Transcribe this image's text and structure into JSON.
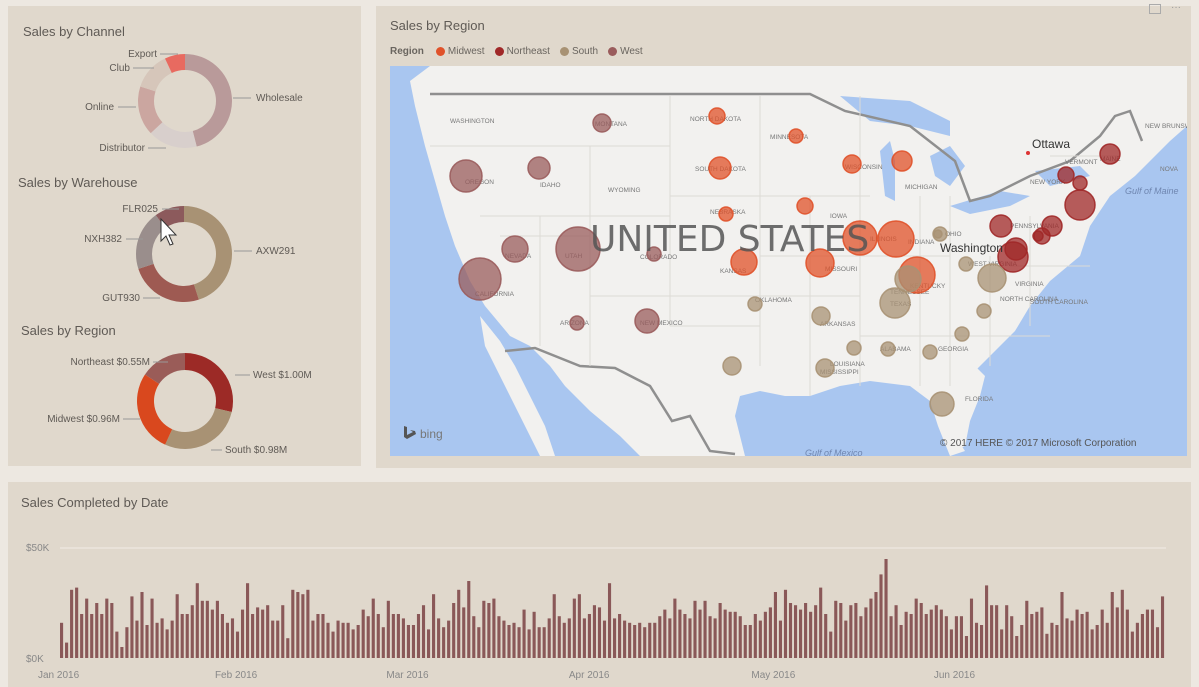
{
  "left_panel": {
    "channel": {
      "title": "Sales by Channel",
      "segments": [
        {
          "label": "Wholesale",
          "share": 0.46,
          "color": "#b99a9a"
        },
        {
          "label": "Distributor",
          "share": 0.17,
          "color": "#d8cfcc"
        },
        {
          "label": "Online",
          "share": 0.17,
          "color": "#cba6a0"
        },
        {
          "label": "Club",
          "share": 0.13,
          "color": "#d6c6ba"
        },
        {
          "label": "Export",
          "share": 0.07,
          "color": "#e86a60"
        }
      ]
    },
    "warehouse": {
      "title": "Sales by Warehouse",
      "segments": [
        {
          "label": "AXW291",
          "share": 0.45,
          "color": "#a89274"
        },
        {
          "label": "GUT930",
          "share": 0.25,
          "color": "#9e5a52"
        },
        {
          "label": "NXH382",
          "share": 0.2,
          "color": "#9a8e8c"
        },
        {
          "label": "FLR025",
          "share": 0.1,
          "color": "#8c5a5c"
        }
      ]
    },
    "region": {
      "title": "Sales by Region",
      "segments": [
        {
          "label": "West $1.00M",
          "share": 0.287,
          "color": "#9c2a26"
        },
        {
          "label": "South $0.98M",
          "share": 0.281,
          "color": "#a89274"
        },
        {
          "label": "Midwest $0.96M",
          "share": 0.275,
          "color": "#d9481e"
        },
        {
          "label": "Northeast $0.55M",
          "share": 0.157,
          "color": "#9a5c58"
        }
      ]
    }
  },
  "map_panel": {
    "title": "Sales by Region",
    "legend_title": "Region",
    "legend": [
      {
        "label": "Midwest",
        "color": "#e0522a"
      },
      {
        "label": "Northeast",
        "color": "#a02828"
      },
      {
        "label": "South",
        "color": "#a89274"
      },
      {
        "label": "West",
        "color": "#9a5c5c"
      }
    ],
    "country_label": "UNITED STATES",
    "city_labels": [
      "Ottawa",
      "Washington"
    ],
    "water_labels": [
      "Gulf of Maine",
      "Gulf of Mexico"
    ],
    "state_labels": [
      "WASHINGTON",
      "MONTANA",
      "NORTH DAKOTA",
      "MINNESOTA",
      "SOUTH DAKOTA",
      "WYOMING",
      "IDAHO",
      "OREGON",
      "NEBRASKA",
      "NEVADA",
      "UTAH",
      "COLORADO",
      "KANSAS",
      "CALIFORNIA",
      "ARIZONA",
      "NEW MEXICO",
      "OKLAHOMA",
      "TEXAS",
      "ARKANSAS",
      "MISSOURI",
      "IOWA",
      "WISCONSIN",
      "MICHIGAN",
      "ILLINOIS",
      "INDIANA",
      "OHIO",
      "KENTUCKY",
      "TENNESSEE",
      "MISSISSIPPI",
      "ALABAMA",
      "GEORGIA",
      "LOUISIANA",
      "FLORIDA",
      "SOUTH CAROLINA",
      "NORTH CAROLINA",
      "VIRGINIA",
      "WEST VIRGINIA",
      "PENNSYLVANIA",
      "NEW YORK",
      "VERMONT",
      "MAINE",
      "NEW BRUNSWICK",
      "NOVA"
    ],
    "attribution": "© 2017 HERE  © 2017 Microsoft Corporation",
    "logo": "bing",
    "icons": [
      "focus-mode-icon",
      "more-options-icon"
    ]
  },
  "date_panel": {
    "title": "Sales Completed by Date"
  },
  "chart_data": {
    "type": "bar",
    "title": "Sales Completed by Date",
    "xlabel": "",
    "ylabel": "",
    "ylim": [
      0,
      50000
    ],
    "y_ticks": [
      "$0K",
      "$50K"
    ],
    "x_tick_labels": [
      "Jan 2016",
      "Feb 2016",
      "Mar 2016",
      "Apr 2016",
      "May 2016",
      "Jun 2016"
    ],
    "grid": true,
    "bar_color": "#8a5858",
    "values_k": [
      16,
      7,
      31,
      32,
      20,
      27,
      20,
      25,
      20,
      27,
      25,
      12,
      5,
      14,
      28,
      17,
      30,
      15,
      27,
      16,
      18,
      13,
      17,
      29,
      20,
      20,
      24,
      34,
      26,
      26,
      22,
      26,
      20,
      16,
      18,
      12,
      22,
      34,
      20,
      23,
      22,
      24,
      17,
      17,
      24,
      9,
      31,
      30,
      29,
      31,
      17,
      20,
      20,
      16,
      12,
      17,
      16,
      16,
      13,
      15,
      22,
      19,
      27,
      20,
      14,
      26,
      20,
      20,
      18,
      15,
      15,
      20,
      24,
      13,
      29,
      18,
      14,
      17,
      25,
      31,
      23,
      35,
      19,
      14,
      26,
      25,
      27,
      19,
      17,
      15,
      16,
      14,
      22,
      13,
      21,
      14,
      14,
      18,
      29,
      19,
      16,
      18,
      27,
      29,
      18,
      20,
      24,
      23,
      17,
      34,
      18,
      20,
      17,
      16,
      15,
      16,
      14,
      16,
      16,
      19,
      22,
      18,
      27,
      22,
      20,
      18,
      26,
      22,
      26,
      19,
      18,
      25,
      22,
      21,
      21,
      19,
      15,
      15,
      20,
      17,
      21,
      23,
      30,
      17,
      31,
      25,
      24,
      22,
      25,
      21,
      24,
      32,
      20,
      12,
      26,
      25,
      17,
      24,
      25,
      19,
      23,
      27,
      30,
      38,
      45,
      19,
      24,
      15,
      21,
      20,
      27,
      25,
      20,
      22,
      24,
      22,
      19,
      13,
      19,
      19,
      10,
      27,
      16,
      15,
      33,
      24,
      24,
      13,
      24,
      19,
      10,
      15,
      26,
      20,
      21,
      23,
      11,
      16,
      15,
      30,
      18,
      17,
      22,
      20,
      21,
      13,
      15,
      22,
      16,
      30,
      23,
      31,
      22,
      12,
      16,
      20,
      22,
      22,
      14,
      28
    ]
  }
}
